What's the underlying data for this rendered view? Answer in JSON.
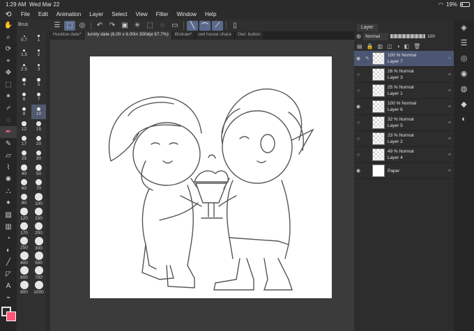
{
  "status": {
    "time": "1:29 AM",
    "date": "Wed Mar 22",
    "battery": "19%"
  },
  "menu": [
    "File",
    "Edit",
    "Animation",
    "Layer",
    "Select",
    "View",
    "Filter",
    "Window",
    "Help"
  ],
  "toolbar_icons": [
    "menu-icon",
    "select-tool-icon",
    "snapshot-icon",
    "undo-icon",
    "redo-icon",
    "fill-icon",
    "rotate-icon",
    "transform-icon",
    "lasso-icon",
    "ruler-icon",
    "pen-ruler-icon",
    "curve-ruler-icon",
    "symmetry-ruler-icon",
    "phone-icon"
  ],
  "sub_tool_header": "Brus",
  "tabs": [
    {
      "label": "Huntlow date*"
    },
    {
      "label": "lumity date (6.00 x 6.00in 300dpi 67.7%)"
    },
    {
      "label": "Birdraw*"
    },
    {
      "label": "owl house chara"
    },
    {
      "label": "Owl. button"
    }
  ],
  "brush_sizes": [
    "0.7",
    "1",
    "1.5",
    "2",
    "2.5",
    "3",
    "4",
    "5",
    "6",
    "7",
    "8",
    "10",
    "12",
    "15",
    "17",
    "20",
    "25",
    "30",
    "40",
    "50",
    "60",
    "70",
    "80",
    "100",
    "120",
    "150",
    "170",
    "200",
    "250",
    "300",
    "400",
    "500",
    "600",
    "700",
    "800",
    "1000"
  ],
  "layer_panel": {
    "tab": "Layer",
    "blend_mode": "Normal",
    "opacity": "100",
    "layers": [
      {
        "opacity": "100 %",
        "mode": "Normal",
        "name": "Layer 7",
        "visible": true,
        "selected": true
      },
      {
        "opacity": "26 %",
        "mode": "Normal",
        "name": "Layer 3",
        "visible": false,
        "selected": false
      },
      {
        "opacity": "25 %",
        "mode": "Normal",
        "name": "Layer 1",
        "visible": false,
        "selected": false
      },
      {
        "opacity": "100 %",
        "mode": "Normal",
        "name": "Layer 6",
        "visible": true,
        "selected": false
      },
      {
        "opacity": "32 %",
        "mode": "Normal",
        "name": "Layer 5",
        "visible": false,
        "selected": false
      },
      {
        "opacity": "23 %",
        "mode": "Normal",
        "name": "Layer 2",
        "visible": false,
        "selected": false
      },
      {
        "opacity": "49 %",
        "mode": "Normal",
        "name": "Layer 4",
        "visible": false,
        "selected": false
      },
      {
        "opacity": "",
        "mode": "",
        "name": "Paper",
        "visible": true,
        "selected": false
      }
    ]
  },
  "colors": {
    "accent": "#5b6a8c",
    "selected_layer": "#4c5672",
    "main_color": "#2b2b2b",
    "sub_color": "#ff5577"
  }
}
